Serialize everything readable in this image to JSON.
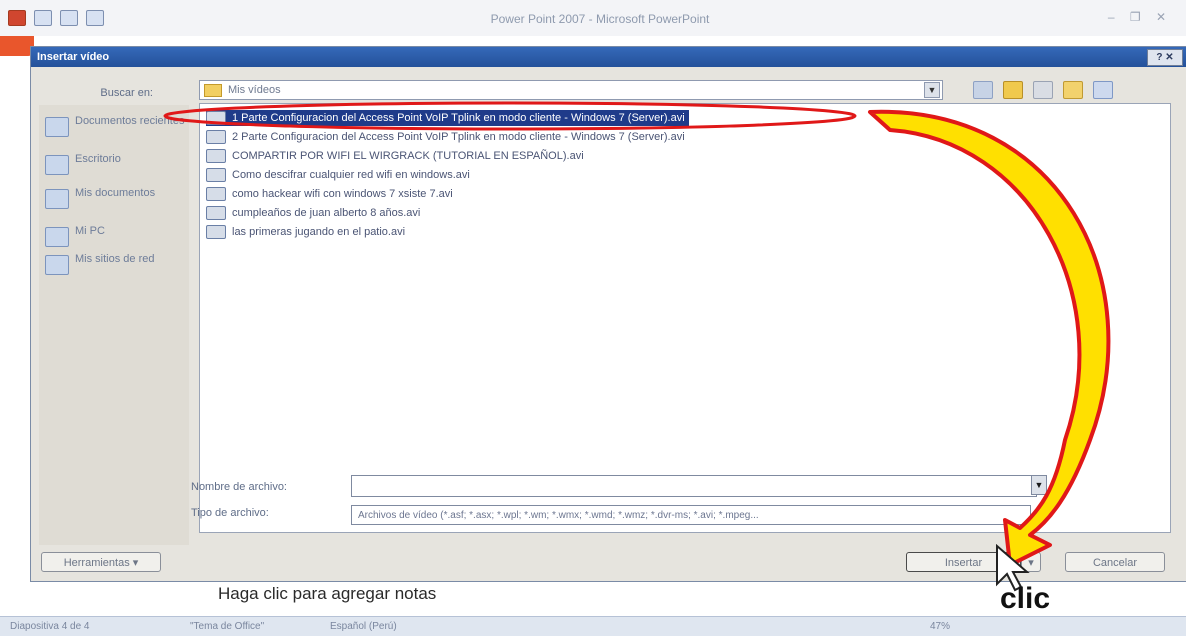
{
  "app": {
    "title": "Power Point 2007 - Microsoft PowerPoint",
    "window_controls": "– ❐ ✕"
  },
  "dialog": {
    "title": "Insertar vídeo",
    "close_label": "? ✕",
    "look_in_label": "Buscar en:",
    "look_in_value": "Mis vídeos",
    "places": [
      "Documentos recientes",
      "Escritorio",
      "Mis documentos",
      "Mi PC",
      "Mis sitios de red"
    ],
    "files": [
      "1 Parte Configuracion del Access Point VoIP Tplink en modo cliente - Windows 7 (Server).avi",
      "2 Parte Configuracion del Access Point VoIP Tplink en modo cliente - Windows 7 (Server).avi",
      "COMPARTIR POR WIFI EL WIRGRACK (TUTORIAL EN ESPAÑOL).avi",
      "Como descifrar cualquier red wifi en windows.avi",
      "como hackear wifi con windows 7 xsiste 7.avi",
      "cumpleaños de juan alberto 8 años.avi",
      "las primeras jugando en el patio.avi"
    ],
    "selected_index": 0,
    "filename_label": "Nombre de archivo:",
    "filename_value": "",
    "filetype_label": "Tipo de archivo:",
    "filetype_value": "Archivos de vídeo (*.asf; *.asx; *.wpl; *.wm; *.wmx; *.wmd; *.wmz; *.dvr-ms; *.avi; *.mpeg...",
    "tools_button": "Herramientas ▾",
    "insert_button": "Insertar",
    "insert_arrow": "▾",
    "cancel_button": "Cancelar"
  },
  "notes": {
    "placeholder": "Haga clic para agregar notas"
  },
  "statusbar": {
    "slide": "Diapositiva 4 de 4",
    "theme": "\"Tema de Office\"",
    "language": "Español (Perú)",
    "zoom": "47%"
  },
  "annotation": {
    "label": "clic",
    "arrow_color": "#ffe000",
    "outline_color": "#e01818"
  }
}
